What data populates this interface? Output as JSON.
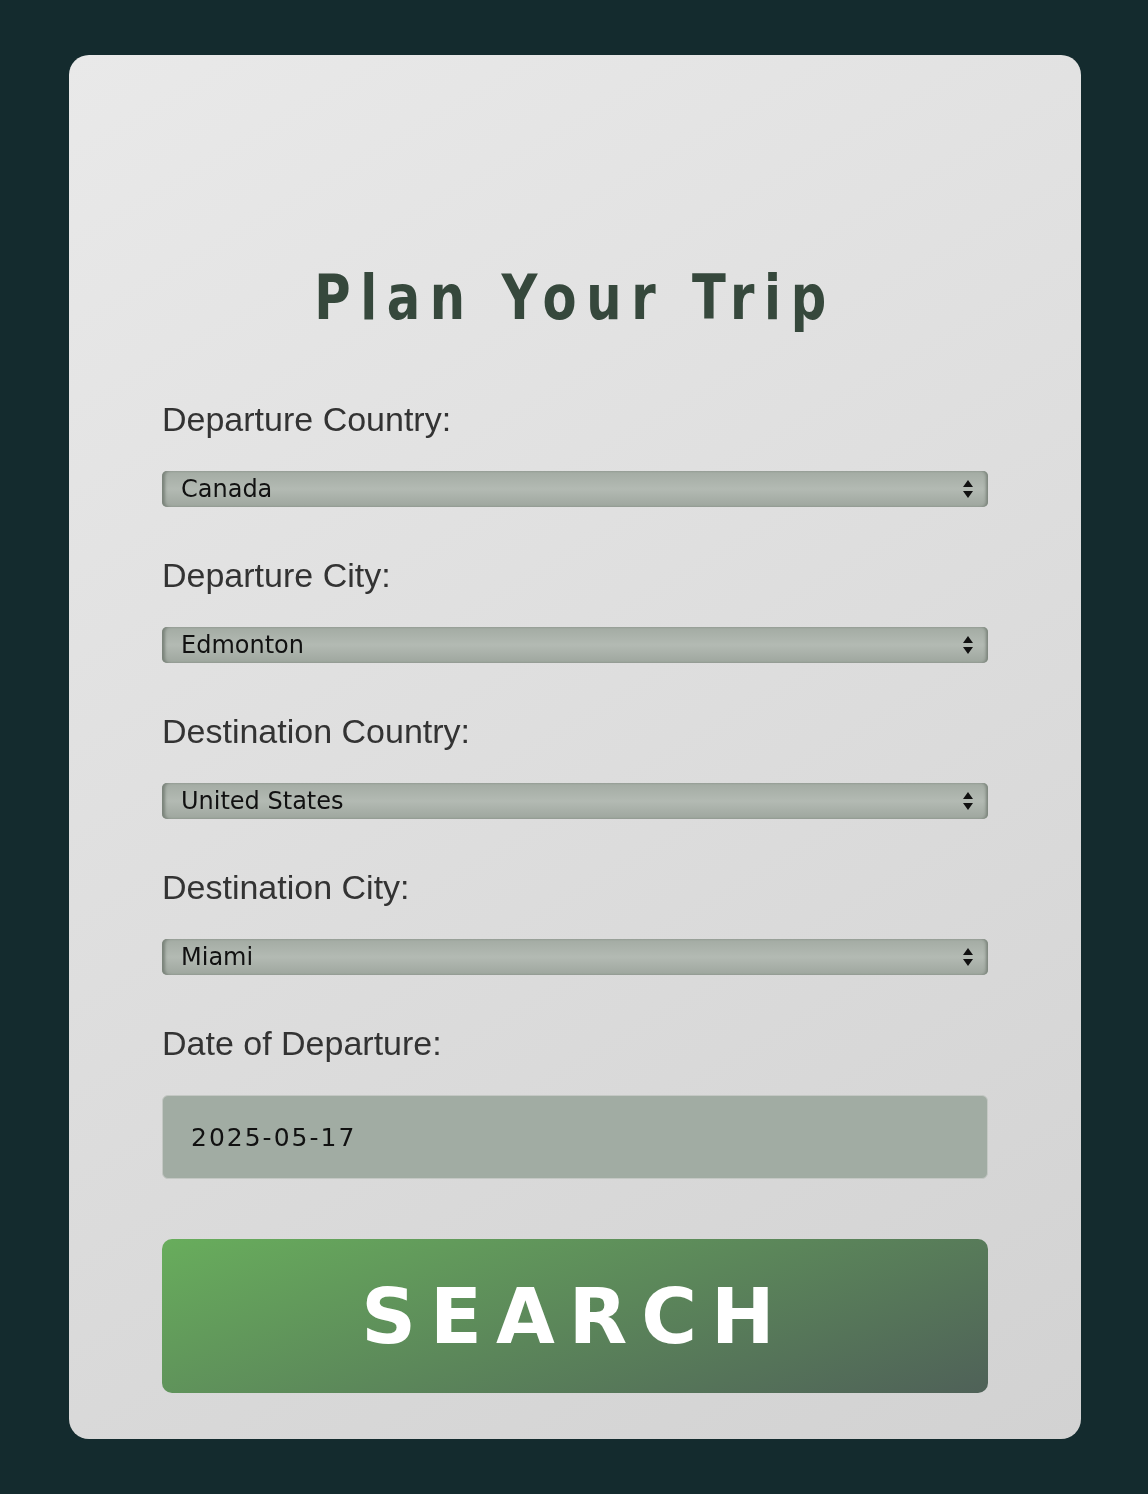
{
  "title": "Plan Your Trip",
  "fields": [
    {
      "kind": "select",
      "label": "Departure Country:",
      "value": "Canada"
    },
    {
      "kind": "select",
      "label": "Departure City:",
      "value": "Edmonton"
    },
    {
      "kind": "select",
      "label": "Destination Country:",
      "value": "United States"
    },
    {
      "kind": "select",
      "label": "Destination City:",
      "value": "Miami"
    },
    {
      "kind": "date",
      "label": "Date of Departure:",
      "value": "2025-05-17"
    }
  ],
  "button": {
    "label": "SEARCH"
  }
}
